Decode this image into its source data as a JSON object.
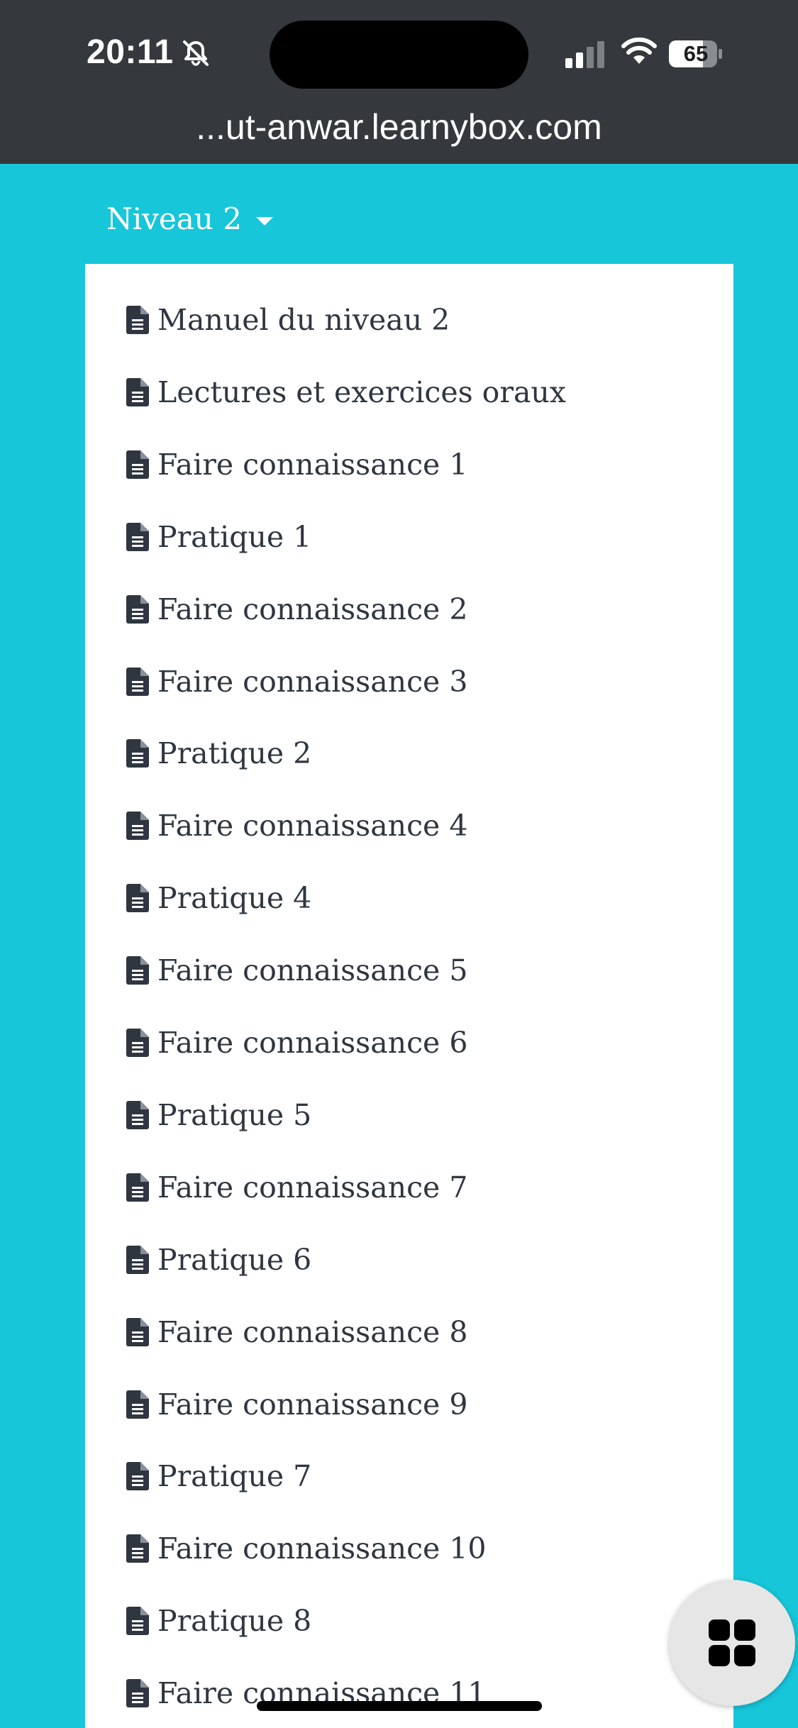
{
  "status_bar": {
    "time": "20:11",
    "battery": "65"
  },
  "browser": {
    "url": "...ut-anwar.learnybox.com"
  },
  "dropdown": {
    "label": "Niveau 2"
  },
  "menu": {
    "items": [
      {
        "label": "Manuel du niveau 2",
        "icon": "document-icon"
      },
      {
        "label": "Lectures et exercices oraux",
        "icon": "document-icon"
      },
      {
        "label": "Faire connaissance 1",
        "icon": "document-icon"
      },
      {
        "label": "Pratique 1",
        "icon": "document-icon"
      },
      {
        "label": "Faire connaissance 2",
        "icon": "document-icon"
      },
      {
        "label": "Faire connaissance 3",
        "icon": "document-icon"
      },
      {
        "label": "Pratique 2",
        "icon": "document-icon"
      },
      {
        "label": "Faire connaissance 4",
        "icon": "document-icon"
      },
      {
        "label": "Pratique 4",
        "icon": "document-icon"
      },
      {
        "label": "Faire connaissance 5",
        "icon": "document-icon"
      },
      {
        "label": "Faire connaissance 6",
        "icon": "document-icon"
      },
      {
        "label": "Pratique 5",
        "icon": "document-icon"
      },
      {
        "label": "Faire connaissance 7",
        "icon": "document-icon"
      },
      {
        "label": "Pratique 6",
        "icon": "document-icon"
      },
      {
        "label": "Faire connaissance 8",
        "icon": "document-icon"
      },
      {
        "label": "Faire connaissance 9",
        "icon": "document-icon"
      },
      {
        "label": "Pratique 7",
        "icon": "document-icon"
      },
      {
        "label": "Faire connaissance 10",
        "icon": "document-icon"
      },
      {
        "label": "Pratique 8",
        "icon": "document-icon"
      },
      {
        "label": "Faire connaissance 11",
        "icon": "document-icon"
      }
    ]
  },
  "fab": {
    "icon": "grid-icon"
  },
  "colors": {
    "background": "#17c6d9",
    "chrome": "#35393d",
    "panel": "#ffffff",
    "text": "#2f3640"
  }
}
